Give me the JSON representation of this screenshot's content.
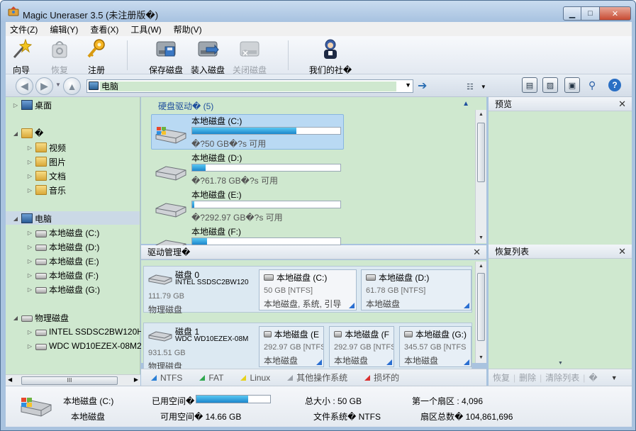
{
  "window": {
    "title": "Magic Uneraser 3.5 (未注册版�)"
  },
  "menu": [
    "文件(Z)",
    "编辑(Y)",
    "查看(X)",
    "工具(W)",
    "帮助(V)"
  ],
  "toolbar": {
    "wizard": "向导",
    "restore": "恢复",
    "register": "注册",
    "save_disk": "保存磁盘",
    "load_disk": "装入磁盘",
    "close_disk": "关闭磁盘",
    "community": "我们的社�"
  },
  "address": {
    "value": "电脑"
  },
  "tree": {
    "desktop": "桌面",
    "library": "�",
    "library_items": [
      "视频",
      "图片",
      "文档",
      "音乐"
    ],
    "computer": "电脑",
    "drives": [
      "本地磁盘 (C:)",
      "本地磁盘 (D:)",
      "本地磁盘 (E:)",
      "本地磁盘 (F:)",
      "本地磁盘 (G:)"
    ],
    "physical": "物理磁盘",
    "physical_items": [
      "INTEL SSDSC2BW120H6",
      "WDC WD10EZEX-08M2N"
    ],
    "scroll_grip": "III"
  },
  "drives_section": {
    "header": "硬盘驱动� (5)",
    "items": [
      {
        "name": "本地磁盘 (C:)",
        "free": "�?50 GB�?s 可用",
        "used_fraction": 0.705
      },
      {
        "name": "本地磁盘 (D:)",
        "free": "�?61.78 GB�?s 可用",
        "used_fraction": 0.09
      },
      {
        "name": "本地磁盘 (E:)",
        "free": "�?292.97 GB�?s 可用",
        "used_fraction": 0.015
      },
      {
        "name": "本地磁盘 (F:)",
        "free": "",
        "used_fraction": 0.1
      }
    ]
  },
  "drive_manager": {
    "title": "驱动管理�",
    "disks": [
      {
        "label": "磁盘 0",
        "model": "INTEL SSDSC2BW120",
        "size": "111.79 GB",
        "kind": "物理磁盘",
        "partitions": [
          {
            "name": "本地磁盘 (C:)",
            "size": "50 GB [NTFS]",
            "type": "本地磁盘, 系统, 引导"
          },
          {
            "name": "本地磁盘 (D:)",
            "size": "61.78 GB [NTFS]",
            "type": "本地磁盘"
          }
        ]
      },
      {
        "label": "磁盘 1",
        "model": "WDC WD10EZEX-08M",
        "size": "931.51 GB",
        "kind": "物理磁盘",
        "partitions": [
          {
            "name": "本地磁盘 (E",
            "size": "292.97 GB [NTFS",
            "type": "本地磁盘"
          },
          {
            "name": "本地磁盘 (F",
            "size": "292.97 GB [NTFS",
            "type": "本地磁盘"
          },
          {
            "name": "本地磁盘 (G:)",
            "size": "345.57 GB [NTFS",
            "type": "本地磁盘"
          }
        ]
      }
    ]
  },
  "legend": [
    {
      "label": "NTFS",
      "color": "#2a7fd6"
    },
    {
      "label": "FAT",
      "color": "#2fa84f"
    },
    {
      "label": "Linux",
      "color": "#e6d21e"
    },
    {
      "label": "其他操作系统",
      "color": "#9aa0a8"
    },
    {
      "label": "损坏的",
      "color": "#d93030"
    }
  ],
  "preview": {
    "title": "预览"
  },
  "recovery_list": {
    "title": "恢复列表",
    "actions": [
      "恢复",
      "删除",
      "清除列表",
      "�"
    ]
  },
  "status": {
    "drive_name": "本地磁盘 (C:)",
    "drive_type": "本地磁盘",
    "used_label": "已用空间�",
    "used_fraction": 0.7,
    "free_label": "可用空间� 14.66 GB",
    "total_size": "总大小 :  50 GB",
    "filesystem": "文件系统� NTFS",
    "first_sector": "第一个扇区 :  4,096",
    "total_sectors": "扇区总数� 104,861,696"
  }
}
